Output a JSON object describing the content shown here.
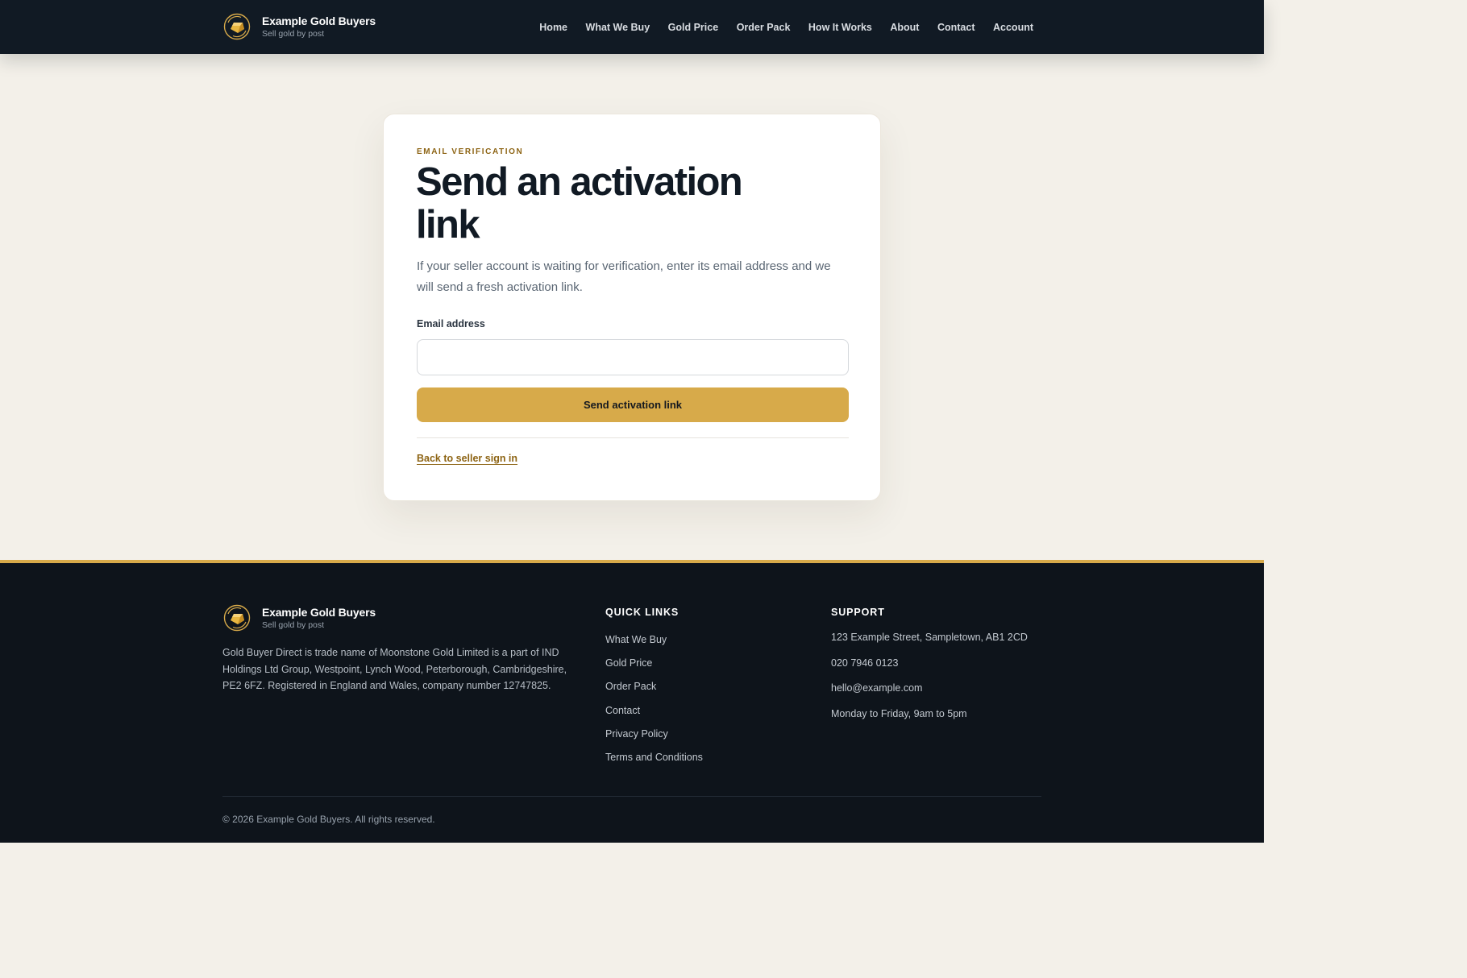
{
  "brand": {
    "name": "Example Gold Buyers",
    "tagline": "Sell gold by post"
  },
  "nav": [
    "Home",
    "What We Buy",
    "Gold Price",
    "Order Pack",
    "How It Works",
    "About",
    "Contact",
    "Account"
  ],
  "card": {
    "eyebrow": "EMAIL VERIFICATION",
    "title": "Send an activation link",
    "lead": "If your seller account is waiting for verification, enter its email address and we will send a fresh activation link.",
    "email_label": "Email address",
    "email_value": "",
    "email_placeholder": "",
    "submit_label": "Send activation link",
    "back_link": "Back to seller sign in"
  },
  "footer": {
    "about": "Gold Buyer Direct is trade name of Moonstone Gold Limited is a part of IND Holdings Ltd Group, Westpoint, Lynch Wood, Peterborough, Cambridgeshire, PE2 6FZ. Registered in England and Wales, company number 12747825.",
    "quick_links_heading": "QUICK LINKS",
    "quick_links": [
      "What We Buy",
      "Gold Price",
      "Order Pack",
      "Contact",
      "Privacy Policy",
      "Terms and Conditions"
    ],
    "support_heading": "SUPPORT",
    "support": {
      "address": "123 Example Street, Sampletown, AB1 2CD",
      "phone": "020 7946 0123",
      "email": "hello@example.com",
      "hours": "Monday to Friday, 9am to 5pm"
    },
    "copyright": "© 2026 Example Gold Buyers. All rights reserved."
  },
  "colors": {
    "header_bg": "#111a24",
    "page_bg": "#f3f0e9",
    "accent_gold": "#d7aa4a",
    "accent_gold_text": "#8d6414",
    "footer_bg": "#0e141b"
  },
  "icons": {
    "logo": "gold-bar-logo-icon"
  }
}
